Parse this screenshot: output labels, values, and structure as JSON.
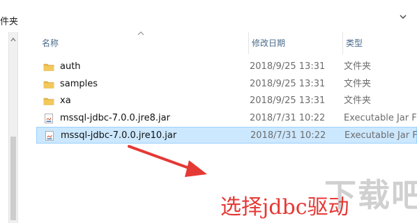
{
  "breadcrumb": {
    "label": "件夹"
  },
  "columns": {
    "name": "名称",
    "date": "修改日期",
    "type": "类型"
  },
  "files": [
    {
      "name": "auth",
      "date": "2018/9/25 13:31",
      "type": "文件夹",
      "icon": "folder-icon",
      "selected": false
    },
    {
      "name": "samples",
      "date": "2018/9/25 13:31",
      "type": "文件夹",
      "icon": "folder-icon",
      "selected": false
    },
    {
      "name": "xa",
      "date": "2018/9/25 13:31",
      "type": "文件夹",
      "icon": "folder-icon",
      "selected": false
    },
    {
      "name": "mssql-jdbc-7.0.0.jre8.jar",
      "date": "2018/7/31 10:22",
      "type": "Executable Jar F",
      "icon": "jar-file-icon",
      "selected": false
    },
    {
      "name": "mssql-jdbc-7.0.0.jre10.jar",
      "date": "2018/7/31 10:22",
      "type": "Executable Jar F",
      "icon": "jar-file-icon",
      "selected": true
    }
  ],
  "annotation": {
    "caption": "选择jdbc驱动",
    "color": "#e53935"
  },
  "watermark": {
    "text": "下载吧"
  },
  "colors": {
    "selection_bg": "#cce8ff",
    "selection_border": "#99d1ff",
    "folder": "#e8b84a",
    "header_text": "#4a6a8a"
  }
}
